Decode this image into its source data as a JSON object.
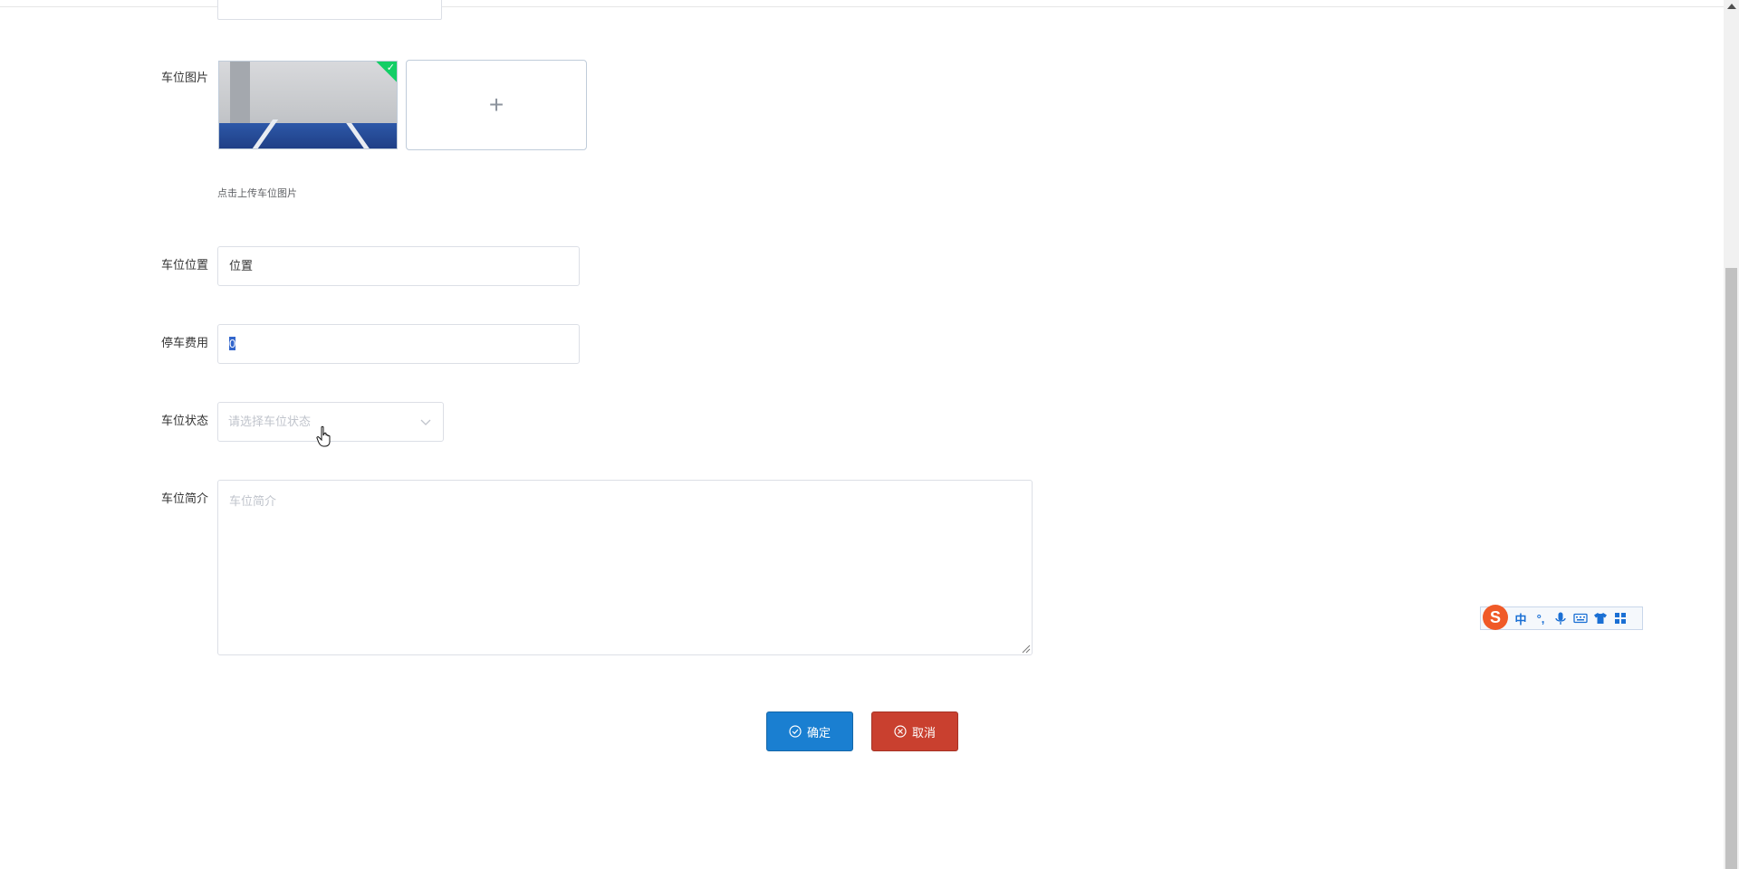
{
  "form": {
    "image_label": "车位图片",
    "upload_plus": "+",
    "upload_tip": "点击上传车位图片",
    "location_label": "车位位置",
    "location_value": "位置",
    "fee_label": "停车费用",
    "fee_value": "0",
    "status_label": "车位状态",
    "status_placeholder": "请选择车位状态",
    "intro_label": "车位简介",
    "intro_placeholder": "车位简介"
  },
  "buttons": {
    "ok_label": "确定",
    "cancel_label": "取消"
  },
  "ime_toolbar": {
    "logo": "S",
    "lang": "中",
    "punct": "°,"
  },
  "colors": {
    "ok_button": "#1a7fd1",
    "cancel_button": "#c9402f",
    "upload_success": "#13ce66"
  }
}
